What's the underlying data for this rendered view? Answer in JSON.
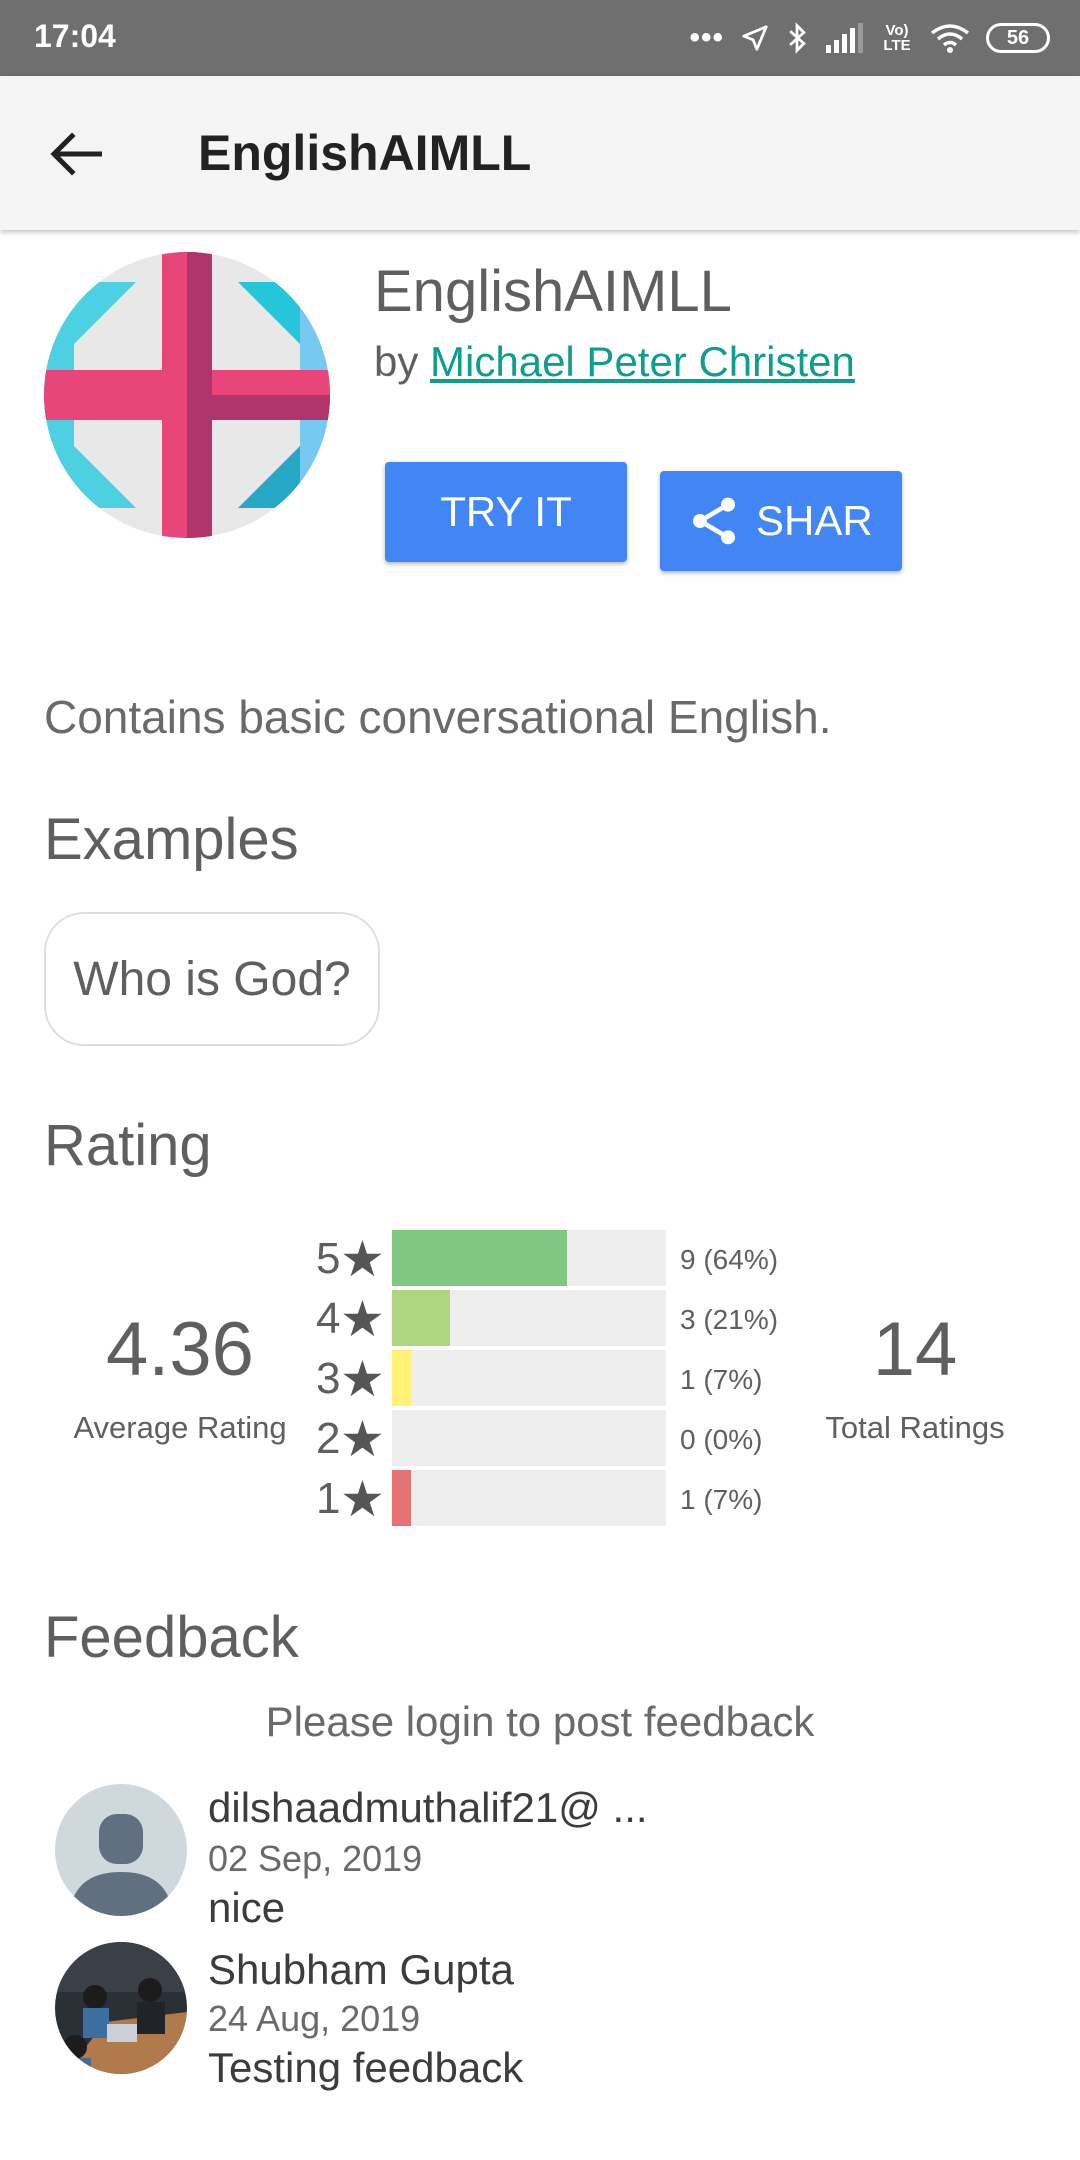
{
  "status_bar": {
    "time": "17:04",
    "network": "Vo) LTE",
    "battery": "56"
  },
  "app_bar": {
    "title": "EnglishAIMLL"
  },
  "bot": {
    "name": "EnglishAIMLL",
    "by_prefix": "by",
    "author": "Michael Peter Christen",
    "try_label": "TRY IT",
    "share_label": "SHAR",
    "description": "Contains basic conversational English."
  },
  "examples": {
    "title": "Examples",
    "items": [
      "Who is God?"
    ]
  },
  "rating": {
    "title": "Rating",
    "average": "4.36",
    "average_label": "Average Rating",
    "total": "14",
    "total_label": "Total Ratings",
    "rows": [
      {
        "stars": "5",
        "fraction": 0.64,
        "label": "9 (64%)",
        "color": "#81c784"
      },
      {
        "stars": "4",
        "fraction": 0.21,
        "label": "3 (21%)",
        "color": "#aed581"
      },
      {
        "stars": "3",
        "fraction": 0.07,
        "label": "1 (7%)",
        "color": "#fff176"
      },
      {
        "stars": "2",
        "fraction": 0.0,
        "label": "0 (0%)",
        "color": "#e0e0e0"
      },
      {
        "stars": "1",
        "fraction": 0.07,
        "label": "1 (7%)",
        "color": "#e57373"
      }
    ]
  },
  "feedback": {
    "title": "Feedback",
    "login_note": "Please login to post feedback",
    "items": [
      {
        "user": "dilshaadmuthalif21@ ...",
        "date": "02 Sep, 2019",
        "text": "nice",
        "avatar": "default-avatar-icon"
      },
      {
        "user": "Shubham Gupta",
        "date": "24 Aug, 2019",
        "text": "Testing feedback",
        "avatar": "user-photo"
      }
    ]
  },
  "colors": {
    "accent": "#4285f4",
    "link": "#0f9d8c",
    "status_bar": "#6f6f6f",
    "app_bar": "#f5f5f5"
  }
}
